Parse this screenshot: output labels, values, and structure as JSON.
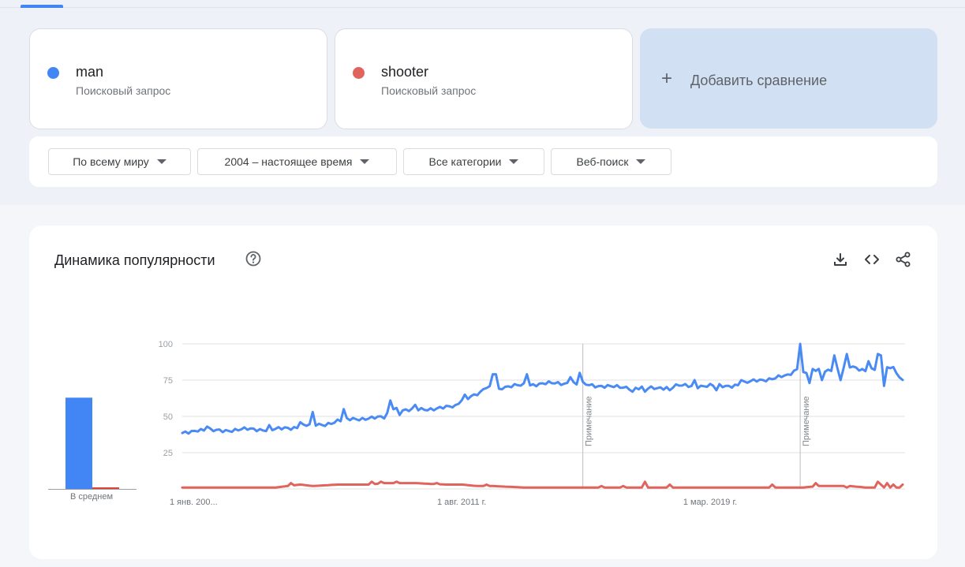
{
  "colors": {
    "series1": "#4285f4",
    "series2": "#db4437",
    "accent": "#4285f4"
  },
  "terms": [
    {
      "name": "man",
      "type": "Поисковый запрос",
      "color": "#4285f4"
    },
    {
      "name": "shooter",
      "type": "Поисковый запрос",
      "color": "#e0645c"
    }
  ],
  "add_comparison": {
    "icon": "plus-icon",
    "label": "Добавить сравнение"
  },
  "filters": [
    {
      "label": "По всему миру"
    },
    {
      "label": "2004 – настоящее время"
    },
    {
      "label": "Все категории"
    },
    {
      "label": "Веб-поиск"
    }
  ],
  "chart": {
    "title": "Динамика популярности",
    "help_icon": "help-circle-icon",
    "tools": [
      "download-icon",
      "embed-code-icon",
      "share-icon"
    ],
    "avg_label": "В среднем",
    "note_label": "Примечание"
  },
  "chart_data": {
    "type": "line",
    "y_ticks": [
      25,
      50,
      75,
      100
    ],
    "ylim": [
      0,
      100
    ],
    "x_tick_labels": [
      "1 янв. 200...",
      "1 авг. 2011 г.",
      "1 мар. 2019 г."
    ],
    "averages": [
      {
        "name": "man",
        "value": 63
      },
      {
        "name": "shooter",
        "value": 1
      }
    ],
    "notes_at_index": [
      129,
      199
    ],
    "series": [
      {
        "name": "man",
        "anchors": [
          [
            0,
            38
          ],
          [
            5,
            41
          ],
          [
            10,
            40
          ],
          [
            20,
            41
          ],
          [
            30,
            41
          ],
          [
            35,
            42
          ],
          [
            40,
            44
          ],
          [
            45,
            44
          ],
          [
            50,
            47
          ],
          [
            55,
            48
          ],
          [
            60,
            49
          ],
          [
            65,
            49
          ],
          [
            68,
            56
          ],
          [
            72,
            54
          ],
          [
            78,
            55
          ],
          [
            85,
            56
          ],
          [
            88,
            57
          ],
          [
            90,
            62
          ],
          [
            95,
            65
          ],
          [
            98,
            70
          ],
          [
            105,
            70
          ],
          [
            110,
            72
          ],
          [
            115,
            72
          ],
          [
            120,
            73
          ],
          [
            125,
            73
          ],
          [
            130,
            72
          ],
          [
            135,
            71
          ],
          [
            140,
            70
          ],
          [
            145,
            70
          ],
          [
            150,
            69
          ],
          [
            155,
            70
          ],
          [
            160,
            71
          ],
          [
            165,
            71
          ],
          [
            170,
            71
          ],
          [
            175,
            71
          ],
          [
            180,
            72
          ],
          [
            185,
            75
          ],
          [
            190,
            76
          ],
          [
            195,
            78
          ],
          [
            198,
            83
          ],
          [
            200,
            80
          ],
          [
            205,
            82
          ],
          [
            210,
            82
          ],
          [
            215,
            84
          ],
          [
            220,
            82
          ],
          [
            225,
            83
          ],
          [
            228,
            83
          ],
          [
            232,
            76
          ]
        ],
        "spikes": [
          [
            8,
            43
          ],
          [
            28,
            44
          ],
          [
            38,
            46
          ],
          [
            42,
            53
          ],
          [
            52,
            55
          ],
          [
            67,
            61
          ],
          [
            75,
            58
          ],
          [
            91,
            65
          ],
          [
            96,
            67
          ],
          [
            100,
            79
          ],
          [
            101,
            79
          ],
          [
            111,
            79
          ],
          [
            125,
            77
          ],
          [
            128,
            80
          ],
          [
            165,
            75
          ],
          [
            180,
            75
          ],
          [
            199,
            100
          ],
          [
            210,
            92
          ],
          [
            214,
            93
          ],
          [
            221,
            88
          ],
          [
            224,
            93
          ],
          [
            225,
            92
          ]
        ],
        "dips": [
          [
            70,
            51
          ],
          [
            102,
            69
          ],
          [
            127,
            72
          ],
          [
            145,
            67
          ],
          [
            149,
            67
          ],
          [
            157,
            68
          ],
          [
            172,
            68
          ],
          [
            202,
            73
          ],
          [
            206,
            75
          ],
          [
            212,
            75
          ],
          [
            226,
            71
          ],
          [
            229,
            84
          ]
        ]
      },
      {
        "name": "shooter",
        "anchors": [
          [
            0,
            1
          ],
          [
            30,
            1
          ],
          [
            34,
            2
          ],
          [
            38,
            3
          ],
          [
            42,
            2
          ],
          [
            50,
            3
          ],
          [
            60,
            3
          ],
          [
            65,
            4
          ],
          [
            75,
            4
          ],
          [
            85,
            3
          ],
          [
            90,
            3
          ],
          [
            95,
            2
          ],
          [
            100,
            2
          ],
          [
            110,
            1
          ],
          [
            150,
            1
          ],
          [
            190,
            1
          ],
          [
            200,
            1
          ],
          [
            205,
            2
          ],
          [
            215,
            2
          ],
          [
            220,
            1
          ],
          [
            232,
            1
          ]
        ],
        "spikes": [
          [
            35,
            4
          ],
          [
            61,
            5
          ],
          [
            64,
            5
          ],
          [
            69,
            5
          ],
          [
            82,
            4
          ],
          [
            98,
            3
          ],
          [
            135,
            2
          ],
          [
            142,
            2
          ],
          [
            149,
            5
          ],
          [
            157,
            3
          ],
          [
            190,
            3
          ],
          [
            204,
            4
          ],
          [
            214,
            1
          ],
          [
            224,
            5
          ],
          [
            225,
            3
          ],
          [
            227,
            4
          ],
          [
            229,
            3
          ],
          [
            232,
            3
          ]
        ],
        "dips": []
      }
    ]
  }
}
